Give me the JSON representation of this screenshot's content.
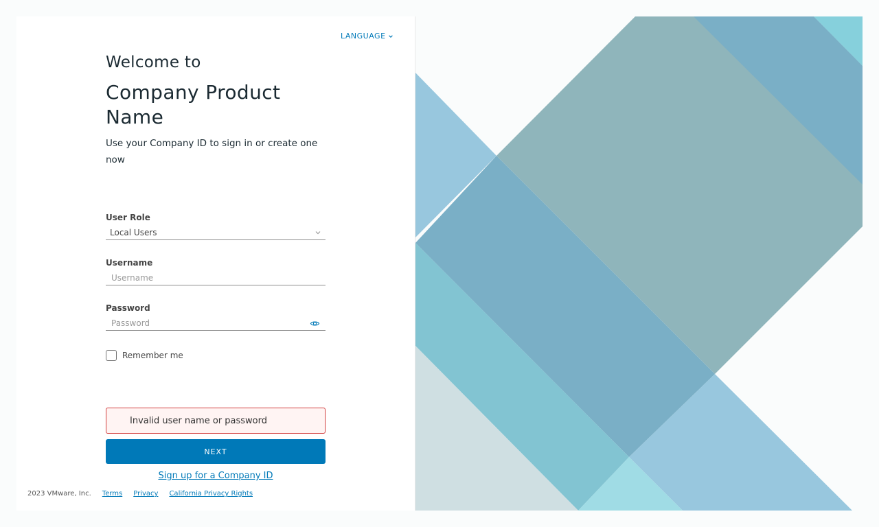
{
  "header": {
    "language_label": "LANGUAGE"
  },
  "hero": {
    "welcome": "Welcome to",
    "product_name": "Company Product Name",
    "subtitle": "Use your Company ID to sign in or create one now"
  },
  "form": {
    "user_role": {
      "label": "User Role",
      "value": "Local Users"
    },
    "username": {
      "label": "Username",
      "value": "",
      "placeholder": "Username"
    },
    "password": {
      "label": "Password",
      "value": "",
      "placeholder": "Password"
    },
    "remember_me": {
      "label": "Remember me",
      "checked": false
    },
    "error_message": "Invalid user name or password",
    "submit_label": "NEXT",
    "signup_link": "Sign up for a Company ID"
  },
  "footer": {
    "copyright": "2023 VMware, Inc.",
    "links": [
      "Terms",
      "Privacy",
      "California Privacy Rights"
    ]
  },
  "icons": {
    "language_chevron": "chevron-down-icon",
    "select_chevron": "chevron-down-icon",
    "password_toggle": "eye-icon"
  },
  "colors": {
    "accent": "#0079b8",
    "error_border": "#d23c3c",
    "error_background": "#fff4f3"
  }
}
